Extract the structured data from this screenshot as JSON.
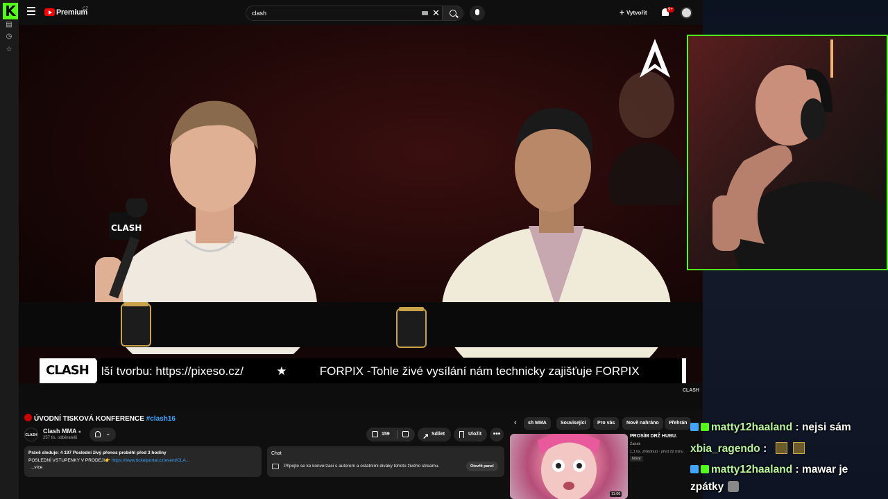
{
  "left_strip": {
    "logo": "K",
    "icons": [
      "list-icon",
      "clock-icon",
      "star-icon"
    ]
  },
  "topbar": {
    "brand": "Premium",
    "region": "CZ",
    "search_value": "clash",
    "create_label": "Vytvořit",
    "notification_count": "9+"
  },
  "player": {
    "chyron_logo": "CLASH",
    "chyron_text": "lší tvorbu: https://pixeso.cz/          ★          FORPIX -Tohle živé vysílání nám technicky zajišťuje FORPIX",
    "watermark": "CLASH"
  },
  "video": {
    "title_prefix": "ÚVODNÍ TISKOVÁ KONFERENCE ",
    "hashtag": "#clash16",
    "channel_name": "Clash MMA",
    "subscribers": "257 tis. odběratelů",
    "channel_avatar_text": "CLASH",
    "like_count": "159",
    "share_label": "Sdílet",
    "save_label": "Uložit",
    "more_label": "•••"
  },
  "description": {
    "line1": "Právě sleduje: 4 197  Poslední živý přenos proběhl před 3 hodiny",
    "line2_text": "POSLEDNÍ VSTUPENKY V PRODEJI👉 ",
    "line2_link": "https://www.ticketportal.cz/event/CLA...",
    "more": "...více"
  },
  "chat_box": {
    "title": "Chat",
    "description": "Připojte se ke konverzaci s autorem a ostatními diváky tohoto živého streamu.",
    "open_button": "Otevřít panel"
  },
  "chips": [
    "sh MMA",
    "Související",
    "Pro vás",
    "Nově nahráno",
    "Přehrán"
  ],
  "recommended": {
    "title": "PROSÍM DRŽ HUBU.",
    "channel": "Žabák",
    "meta": "1,1 tis. zhlédnutí · před 22 minu",
    "badge": "Nový",
    "duration": "11:06"
  },
  "kick_chat": [
    {
      "user": "matty12haaland",
      "message": " : nejsi sám",
      "icon_color": "#3ea6ff"
    },
    {
      "user": "xbia_ragendo",
      "message": " : ",
      "icon_color": ""
    },
    {
      "user": "matty12haaland",
      "message": " : mawar je",
      "icon_color": "#3ea6ff"
    },
    {
      "user": "",
      "message": "zpátky",
      "icon_color": ""
    }
  ],
  "colors": {
    "kick_green": "#53fc18",
    "youtube_red": "#ff0000",
    "link_blue": "#3ea6ff"
  }
}
